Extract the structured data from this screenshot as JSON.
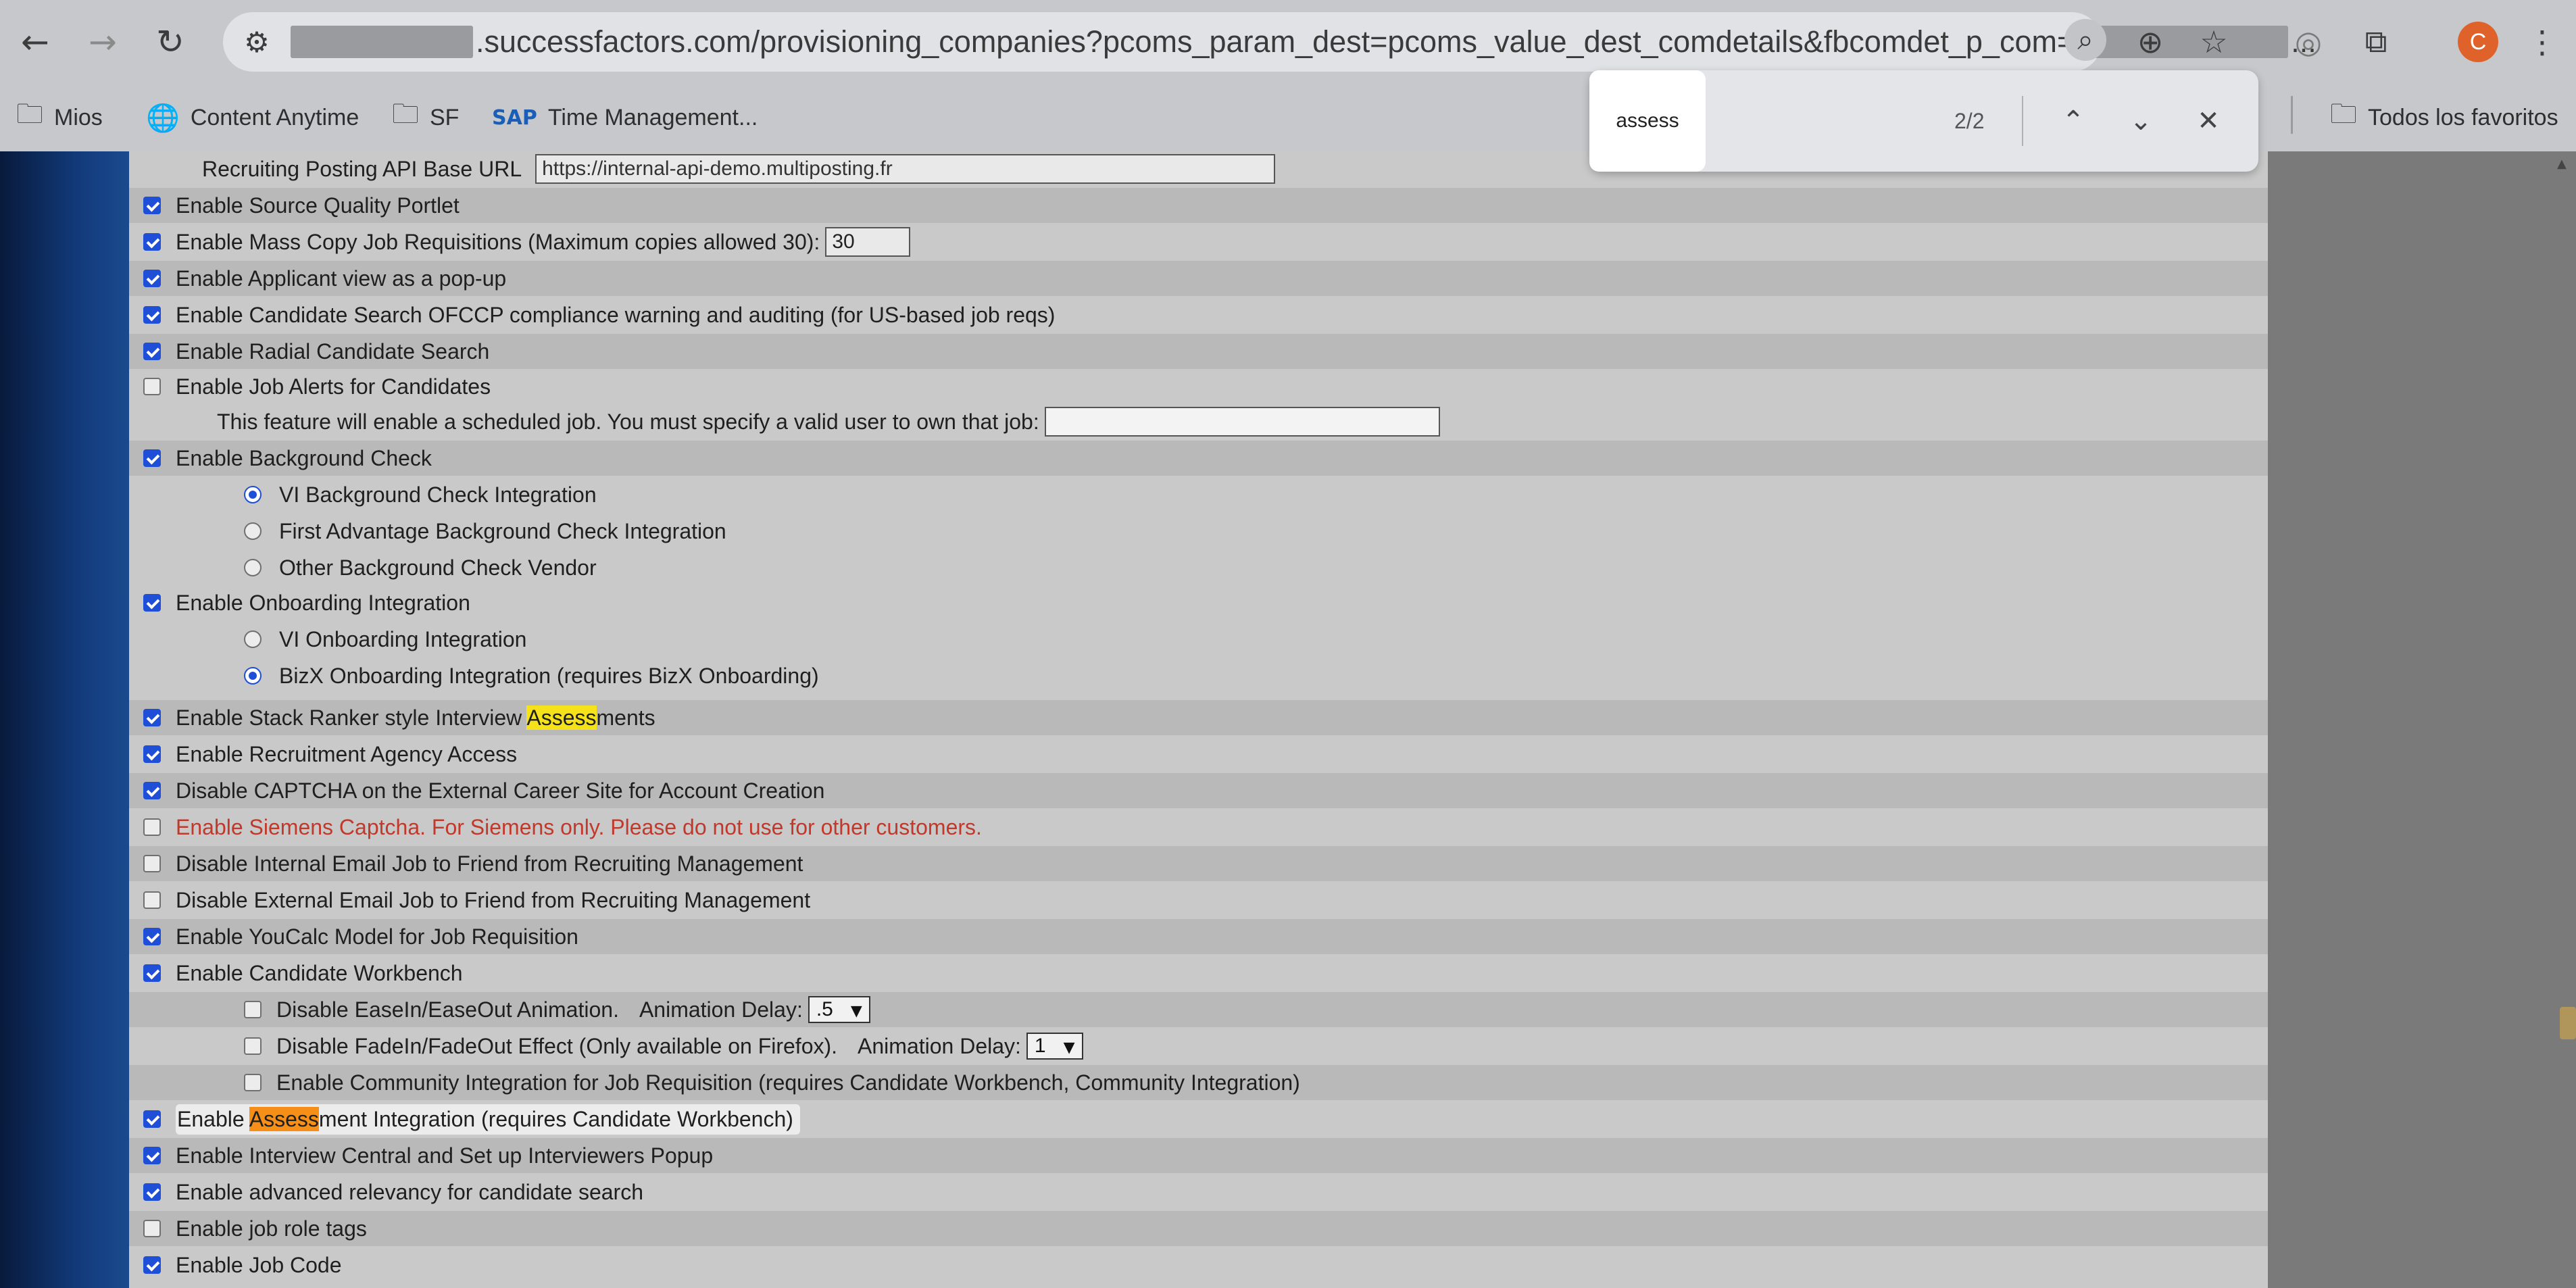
{
  "browser": {
    "url_domain": ".successfactors.com",
    "url_path": "/provisioning_companies?pcoms_param_dest=pcoms_value_dest_comdetails&fbcomdet_p_com=",
    "url_suffix": "...",
    "avatar_letter": "C",
    "bookmarks": [
      {
        "icon": "folder-icon",
        "label": "Mios"
      },
      {
        "icon": "globe-icon",
        "label": "Content Anytime"
      },
      {
        "icon": "folder-icon",
        "label": "SF"
      },
      {
        "icon": "sap-icon",
        "label": "Time Management..."
      }
    ],
    "all_bookmarks_label": "Todos los favoritos"
  },
  "find_bar": {
    "query": "assess",
    "count": "2/2"
  },
  "settings": {
    "posting_api_label": "Recruiting Posting API Base URL",
    "posting_api_value": "https://internal-api-demo.multiposting.fr",
    "source_quality": "Enable Source Quality Portlet",
    "mass_copy": "Enable Mass Copy Job Requisitions (Maximum copies allowed 30):",
    "mass_copy_value": "30",
    "applicant_popup": "Enable Applicant view as a pop-up",
    "ofccp": "Enable Candidate Search OFCCP compliance warning and auditing (for US-based job reqs)",
    "radial_search": "Enable Radial Candidate Search",
    "job_alerts": "Enable Job Alerts for Candidates",
    "job_alerts_note": "This feature will enable a scheduled job. You must specify a valid user to own that job:",
    "job_alerts_user": "",
    "background_check": "Enable Background Check",
    "bg_vi": "VI Background Check Integration",
    "bg_first_advantage": "First Advantage Background Check Integration",
    "bg_other": "Other Background Check Vendor",
    "onboarding": "Enable Onboarding Integration",
    "onb_vi": "VI Onboarding Integration",
    "onb_bizx": "BizX Onboarding Integration (requires BizX Onboarding)",
    "stack_ranker_pre": "Enable Stack Ranker style Interview ",
    "stack_ranker_hl": "Assess",
    "stack_ranker_post": "ments",
    "agency_access": "Enable Recruitment Agency Access",
    "disable_captcha": "Disable CAPTCHA on the External Career Site for Account Creation",
    "siemens_captcha": "Enable Siemens Captcha. For Siemens only. Please do not use for other customers.",
    "disable_internal_email": "Disable Internal Email Job to Friend from Recruiting Management",
    "disable_external_email": "Disable External Email Job to Friend from Recruiting Management",
    "youcalc": "Enable YouCalc Model for Job Requisition",
    "candidate_workbench": "Enable Candidate Workbench",
    "ease_label": "Disable EaseIn/EaseOut Animation.",
    "ease_delay_label": "Animation Delay:",
    "ease_delay_value": ".5",
    "fade_label": "Disable FadeIn/FadeOut Effect (Only available on Firefox).",
    "fade_delay_label": "Animation Delay:",
    "fade_delay_value": "1",
    "community": "Enable Community Integration for Job Requisition (requires Candidate Workbench, Community Integration)",
    "assessment_pre": "Enable ",
    "assessment_hl": "Assess",
    "assessment_post": "ment Integration (requires Candidate Workbench)",
    "interview_central": "Enable Interview Central and Set up Interviewers Popup",
    "advanced_relevancy": "Enable advanced relevancy for candidate search",
    "job_role_tags": "Enable job role tags",
    "job_code": "Enable Job Code"
  }
}
